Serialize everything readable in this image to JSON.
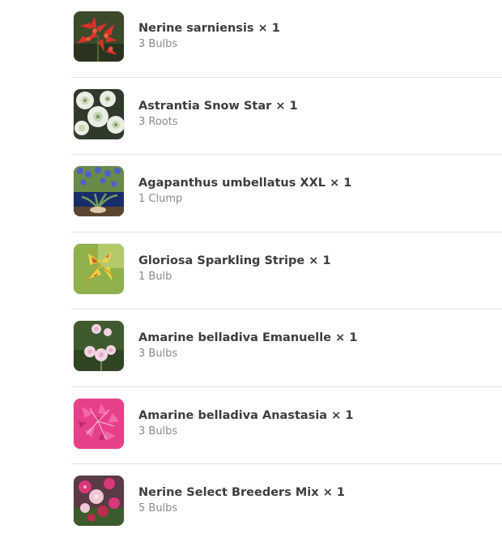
{
  "items": [
    {
      "name": "Nerine sarniensis",
      "qty": "× 1",
      "detail": "3 Bulbs",
      "image": "nerine-sarniensis-photo"
    },
    {
      "name": "Astrantia Snow Star",
      "qty": "× 1",
      "detail": "3 Roots",
      "image": "astrantia-snow-star-photo"
    },
    {
      "name": "Agapanthus umbellatus XXL",
      "qty": "× 1",
      "detail": "1 Clump",
      "image": "agapanthus-umbellatus-photo"
    },
    {
      "name": "Gloriosa Sparkling Stripe",
      "qty": "× 1",
      "detail": "1 Bulb",
      "image": "gloriosa-sparkling-stripe-photo"
    },
    {
      "name": "Amarine belladiva Emanuelle",
      "qty": "× 1",
      "detail": "3 Bulbs",
      "image": "amarine-emanuelle-photo"
    },
    {
      "name": "Amarine belladiva Anastasia",
      "qty": "× 1",
      "detail": "3 Bulbs",
      "image": "amarine-anastasia-photo"
    },
    {
      "name": "Nerine Select Breeders Mix",
      "qty": "× 1",
      "detail": "5 Bulbs",
      "image": "nerine-breeders-mix-photo"
    }
  ]
}
